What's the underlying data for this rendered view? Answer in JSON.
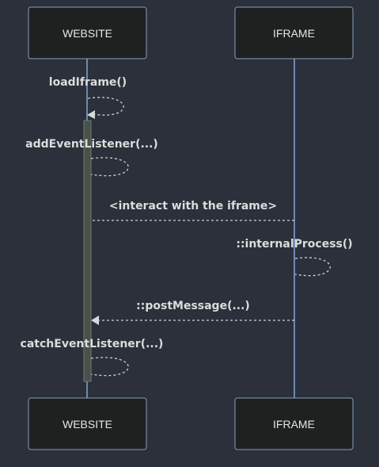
{
  "diagram": {
    "actors": [
      {
        "id": "website",
        "label": "WEBSITE"
      },
      {
        "id": "iframe",
        "label": "IFRAME"
      }
    ],
    "messages": [
      {
        "label": "loadIframe()",
        "from": "website",
        "to": "website"
      },
      {
        "label": "addEventListener(...)",
        "from": "website",
        "to": "website"
      },
      {
        "label": "<interact with the iframe>",
        "from": "iframe",
        "to": "website",
        "arrowhead": false
      },
      {
        "label": "::internalProcess()",
        "from": "iframe",
        "to": "iframe"
      },
      {
        "label": "::postMessage(...)",
        "from": "iframe",
        "to": "website",
        "arrowhead": true
      },
      {
        "label": "catchEventListener(...)",
        "from": "website",
        "to": "website"
      }
    ]
  }
}
